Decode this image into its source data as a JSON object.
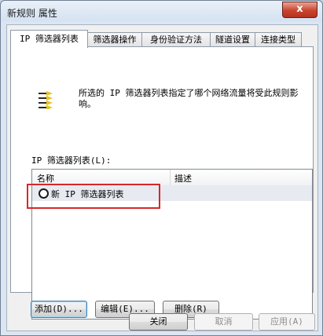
{
  "window": {
    "title": "新规则 属性",
    "close_label": "x"
  },
  "tabs": [
    {
      "label": "IP 筛选器列表",
      "active": true
    },
    {
      "label": "筛选器操作",
      "active": false
    },
    {
      "label": "身份验证方法",
      "active": false
    },
    {
      "label": "隧道设置",
      "active": false
    },
    {
      "label": "连接类型",
      "active": false
    }
  ],
  "panel": {
    "description": "所选的 IP 筛选器列表指定了哪个网络流量将受此规则影响。",
    "list_label": "IP 筛选器列表(L):",
    "columns": {
      "name": "名称",
      "description": "描述"
    },
    "rows": [
      {
        "name": "新 IP 筛选器列表",
        "description": "",
        "selected": true
      }
    ],
    "buttons": {
      "add": "添加(D)...",
      "edit": "编辑(E)...",
      "remove": "删除(R)"
    }
  },
  "footer": {
    "close": "关闭",
    "cancel": "取消",
    "apply": "应用(A)"
  },
  "colors": {
    "highlight_box": "#d6272b"
  }
}
